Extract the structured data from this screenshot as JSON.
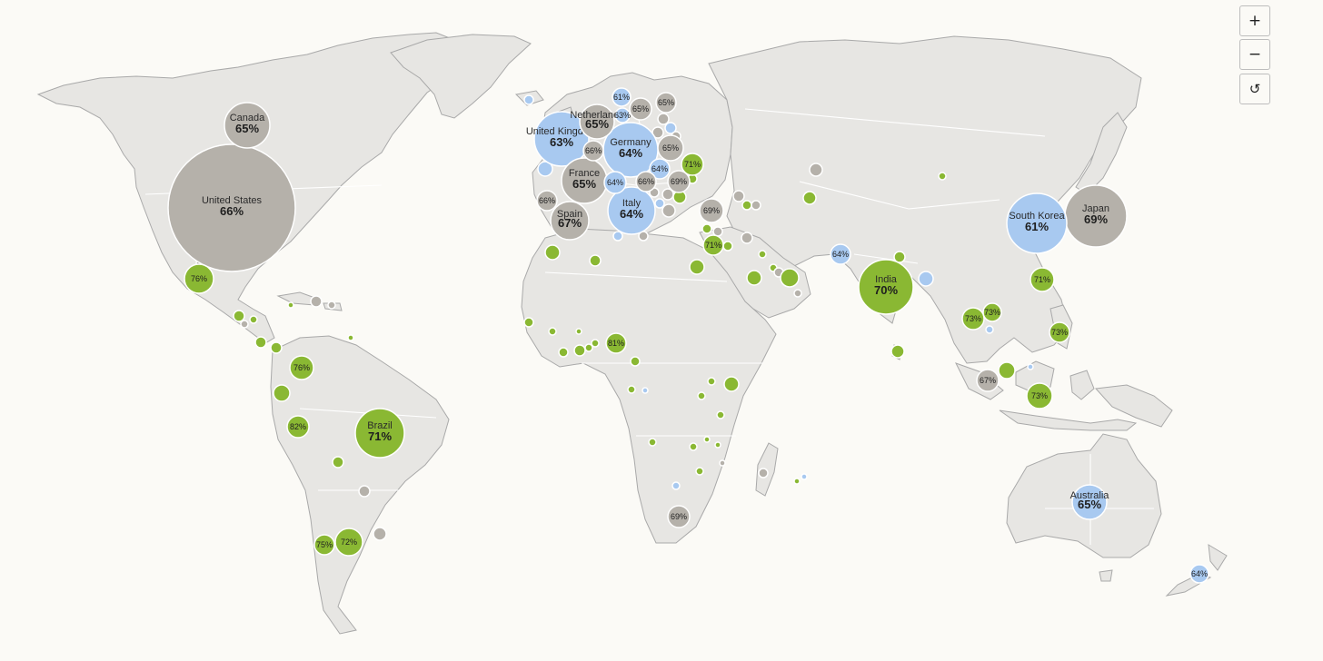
{
  "controls": {
    "zoom_in": {
      "label": "+"
    },
    "zoom_out": {
      "label": "−"
    },
    "reset": {
      "label": "↺"
    }
  },
  "colors": {
    "green": "#8ab833",
    "blue": "#a8c9f0",
    "gray": "#b5b1aa",
    "land": "#e7e6e3",
    "background": "#fbfaf6"
  },
  "countries": [
    {
      "name": "United States",
      "value": "66%",
      "color": "gray"
    },
    {
      "name": "Canada",
      "value": "65%",
      "color": "gray"
    },
    {
      "name": "Brazil",
      "value": "71%",
      "color": "green"
    },
    {
      "name": "India",
      "value": "70%",
      "color": "green"
    },
    {
      "name": "Japan",
      "value": "69%",
      "color": "gray"
    },
    {
      "name": "South Korea",
      "value": "61%",
      "color": "blue"
    },
    {
      "name": "United Kingdom",
      "value": "63%",
      "color": "blue"
    },
    {
      "name": "Germany",
      "value": "64%",
      "color": "blue"
    },
    {
      "name": "France",
      "value": "65%",
      "color": "gray"
    },
    {
      "name": "Italy",
      "value": "64%",
      "color": "blue"
    },
    {
      "name": "Spain",
      "value": "67%",
      "color": "gray"
    },
    {
      "name": "Netherlands",
      "value": "65%",
      "color": "gray"
    },
    {
      "name": "Australia",
      "value": "65%",
      "color": "blue"
    }
  ],
  "unnamed_values": [
    {
      "value": "76%",
      "color": "green"
    },
    {
      "value": "76%",
      "color": "green"
    },
    {
      "value": "82%",
      "color": "green"
    },
    {
      "value": "75%",
      "color": "green"
    },
    {
      "value": "72%",
      "color": "green"
    },
    {
      "value": "81%",
      "color": "green"
    },
    {
      "value": "69%",
      "color": "gray"
    },
    {
      "value": "71%",
      "color": "green"
    },
    {
      "value": "69%",
      "color": "gray"
    },
    {
      "value": "64%",
      "color": "blue"
    },
    {
      "value": "71%",
      "color": "green"
    },
    {
      "value": "73%",
      "color": "green"
    },
    {
      "value": "73%",
      "color": "green"
    },
    {
      "value": "73%",
      "color": "green"
    },
    {
      "value": "67%",
      "color": "gray"
    },
    {
      "value": "73%",
      "color": "green"
    },
    {
      "value": "64%",
      "color": "blue"
    },
    {
      "value": "66%",
      "color": "gray"
    },
    {
      "value": "61%",
      "color": "blue"
    },
    {
      "value": "65%",
      "color": "gray"
    },
    {
      "value": "63%",
      "color": "blue"
    },
    {
      "value": "65%",
      "color": "gray"
    },
    {
      "value": "65%",
      "color": "gray"
    },
    {
      "value": "66%",
      "color": "gray"
    },
    {
      "value": "64%",
      "color": "blue"
    },
    {
      "value": "64%",
      "color": "blue"
    },
    {
      "value": "66%",
      "color": "gray"
    },
    {
      "value": "69%",
      "color": "gray"
    },
    {
      "value": "71%",
      "color": "green"
    },
    {
      "value": "69%",
      "color": "gray"
    }
  ]
}
